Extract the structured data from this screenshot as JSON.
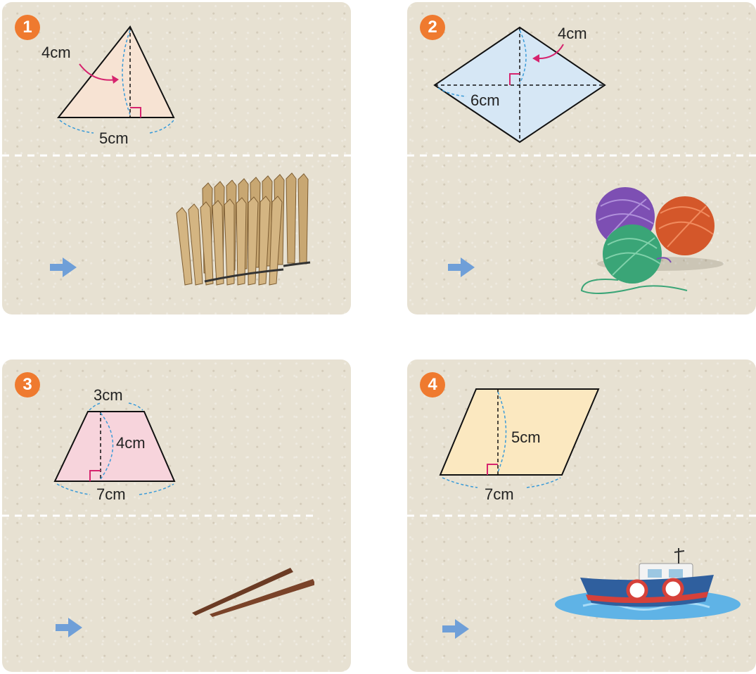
{
  "cards": [
    {
      "number": "1",
      "base_label": "5cm",
      "height_label": "4cm",
      "object_icon": "dried-fish-bundle-icon"
    },
    {
      "number": "2",
      "diagonal_horizontal_label": "6cm",
      "diagonal_vertical_label": "4cm",
      "object_icon": "yarn-balls-icon"
    },
    {
      "number": "3",
      "top_label": "3cm",
      "height_label": "4cm",
      "base_label": "7cm",
      "object_icon": "chopsticks-icon"
    },
    {
      "number": "4",
      "height_label": "5cm",
      "base_label": "7cm",
      "object_icon": "boat-icon"
    }
  ],
  "colors": {
    "number_badge": "#ef7a2f",
    "triangle_fill": "#f7e3d3",
    "rhombus_fill": "#d6e7f5",
    "trapezoid_fill": "#f7d4dc",
    "parallelogram_fill": "#fbe8c0",
    "arrow": "#6f9fd8",
    "brace": "#3b9bd8",
    "pointer": "#d6246e",
    "right_angle": "#d6246e"
  }
}
